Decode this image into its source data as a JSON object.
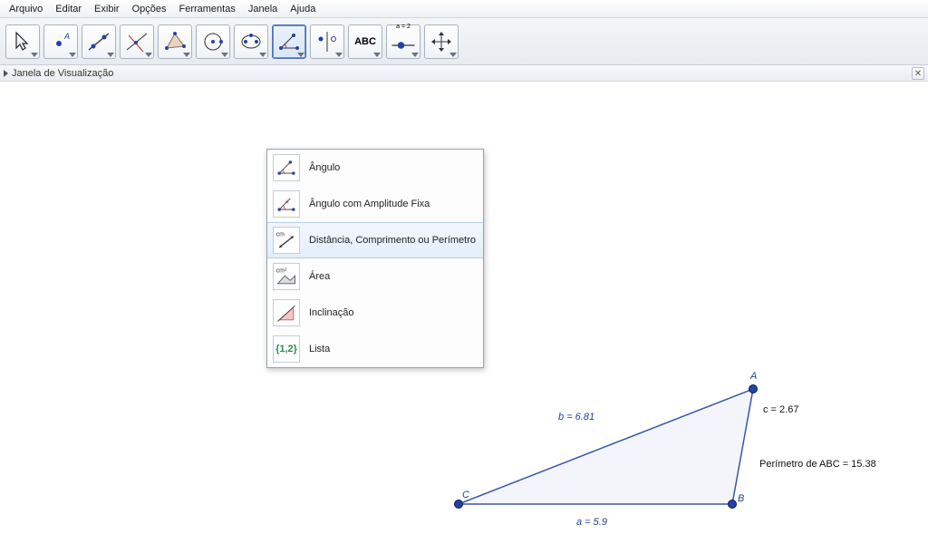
{
  "menu": {
    "arquivo": "Arquivo",
    "editar": "Editar",
    "exibir": "Exibir",
    "opcoes": "Opções",
    "ferramentas": "Ferramentas",
    "janela": "Janela",
    "ajuda": "Ajuda"
  },
  "panel": {
    "title": "Janela de Visualização"
  },
  "toolbar": {
    "abc_label": "ABC",
    "slider_label": "a = 2"
  },
  "dropdown": {
    "angulo": "Ângulo",
    "angulo_amp": "Ângulo com Amplitude Fixa",
    "distancia": "Distância, Comprimento ou Perímetro",
    "area": "Área",
    "inclinacao": "Inclinação",
    "lista": "Lista",
    "lista_icon": "{1,2}",
    "cm_label": "cm",
    "cm2_label": "cm²"
  },
  "graph": {
    "A": "A",
    "B": "B",
    "C": "C",
    "a": "a = 5.9",
    "b": "b = 6.81",
    "c": "c = 2.67",
    "perimetro": "Perímetro de  ABC = 15.38"
  },
  "chart_data": {
    "type": "table",
    "title": "Triangle ABC measurements",
    "vertices": [
      "A",
      "B",
      "C"
    ],
    "sides": [
      {
        "name": "a",
        "opposite_vertex": "A",
        "length": 5.9
      },
      {
        "name": "b",
        "opposite_vertex": "B",
        "length": 6.81
      },
      {
        "name": "c",
        "opposite_vertex": "C",
        "length": 2.67
      }
    ],
    "perimeter": 15.38
  }
}
